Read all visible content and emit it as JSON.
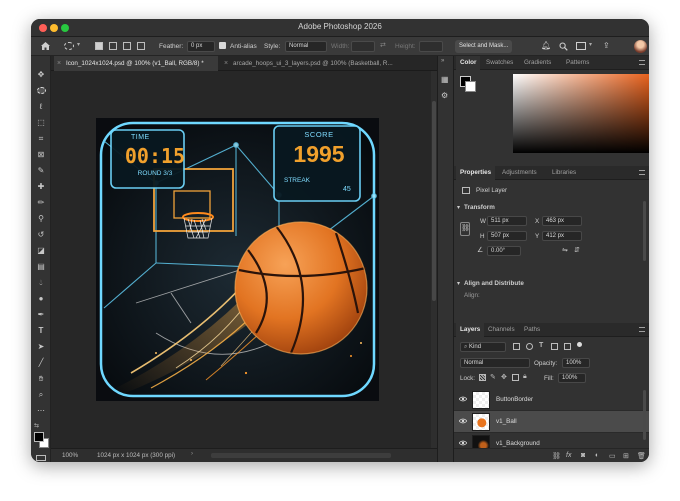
{
  "window": {
    "title": "Adobe Photoshop 2026"
  },
  "options_bar": {
    "feather_label": "Feather:",
    "feather_value": "0 px",
    "antialias_label": "Anti-alias",
    "style_label": "Style:",
    "style_value": "Normal",
    "width_label": "Width:",
    "height_label": "Height:",
    "select_mask_label": "Select and Mask..."
  },
  "tabs": [
    {
      "label": "Icon_1024x1024.psd @ 100% (v1_Ball, RGB/8) *",
      "active": true
    },
    {
      "label": "arcade_hoops_ui_3_layers.psd @ 100% (Basketball, R...",
      "active": false
    }
  ],
  "status": {
    "zoom": "100%",
    "doc_info": "1024 px x 1024 px (300 ppi)"
  },
  "artwork": {
    "time_label": "TIME",
    "time_value": "00:15",
    "round_label": "ROUND 3/3",
    "score_label": "SCORE",
    "score_value": "1995",
    "streak_label": "STREAK",
    "streak_value": "45"
  },
  "color_panel": {
    "tabs": [
      "Color",
      "Swatches",
      "Gradients",
      "Patterns"
    ],
    "hue_color": "#e8601a"
  },
  "properties_panel": {
    "tabs": [
      "Properties",
      "Adjustments",
      "Libraries"
    ],
    "layer_type": "Pixel Layer",
    "transform_title": "Transform",
    "w_label": "W",
    "w_value": "511 px",
    "x_label": "X",
    "x_value": "463 px",
    "h_label": "H",
    "h_value": "507 px",
    "y_label": "Y",
    "y_value": "412 px",
    "angle_value": "0.00°",
    "align_title": "Align and Distribute",
    "align_label": "Align:"
  },
  "layers_panel": {
    "tabs": [
      "Layers",
      "Channels",
      "Paths"
    ],
    "kind_label": "Kind",
    "blend_mode": "Normal",
    "opacity_label": "Opacity:",
    "opacity_value": "100%",
    "lock_label": "Lock:",
    "fill_label": "Fill:",
    "fill_value": "100%",
    "layers": [
      {
        "name": "ButtonBorder",
        "selected": false
      },
      {
        "name": "v1_Ball",
        "selected": true
      },
      {
        "name": "v1_Background",
        "selected": false
      }
    ]
  },
  "colors": {
    "accent_cyan": "#6fd8ff",
    "score_orange": "#f0a02c",
    "ball_orange": "#e8741e"
  }
}
